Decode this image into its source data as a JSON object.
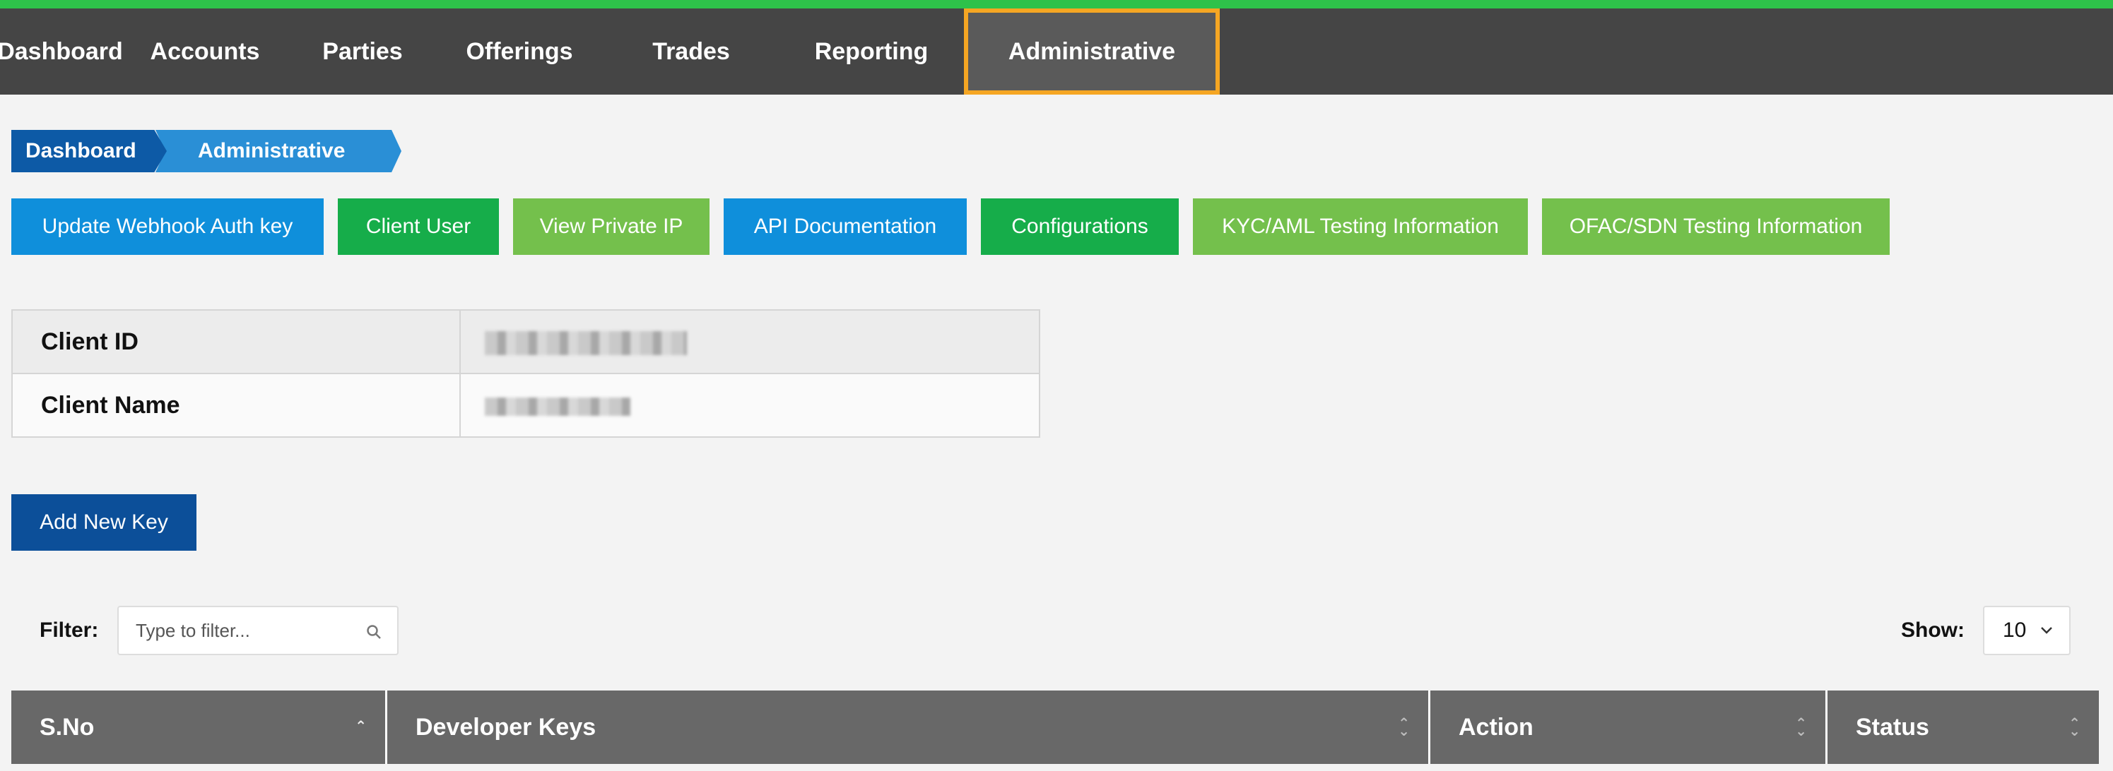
{
  "nav": {
    "items": [
      "Dashboard",
      "Accounts",
      "Parties",
      "Offerings",
      "Trades",
      "Reporting",
      "Administrative"
    ],
    "active": "Administrative"
  },
  "breadcrumb": [
    "Dashboard",
    "Administrative"
  ],
  "actions": [
    {
      "label": "Update Webhook Auth key",
      "color": "#0f8fdb"
    },
    {
      "label": "Client User",
      "color": "#16ad4a"
    },
    {
      "label": "View Private IP",
      "color": "#74c04c"
    },
    {
      "label": "API Documentation",
      "color": "#0f8fdb"
    },
    {
      "label": "Configurations",
      "color": "#16ad4a"
    },
    {
      "label": "KYC/AML Testing Information",
      "color": "#74c04c"
    },
    {
      "label": "OFAC/SDN Testing Information",
      "color": "#74c04c"
    }
  ],
  "client_info": {
    "client_id_label": "Client ID",
    "client_name_label": "Client Name"
  },
  "add_key_label": "Add New Key",
  "filter": {
    "label": "Filter:",
    "placeholder": "Type to filter..."
  },
  "show": {
    "label": "Show:",
    "value": "10"
  },
  "table": {
    "columns": [
      "S.No",
      "Developer Keys",
      "Action",
      "Status"
    ]
  },
  "colors": {
    "accent_green": "#2ec24a",
    "nav_bg": "#454545",
    "active_outline": "#f5a623",
    "header_bg": "#686868"
  }
}
